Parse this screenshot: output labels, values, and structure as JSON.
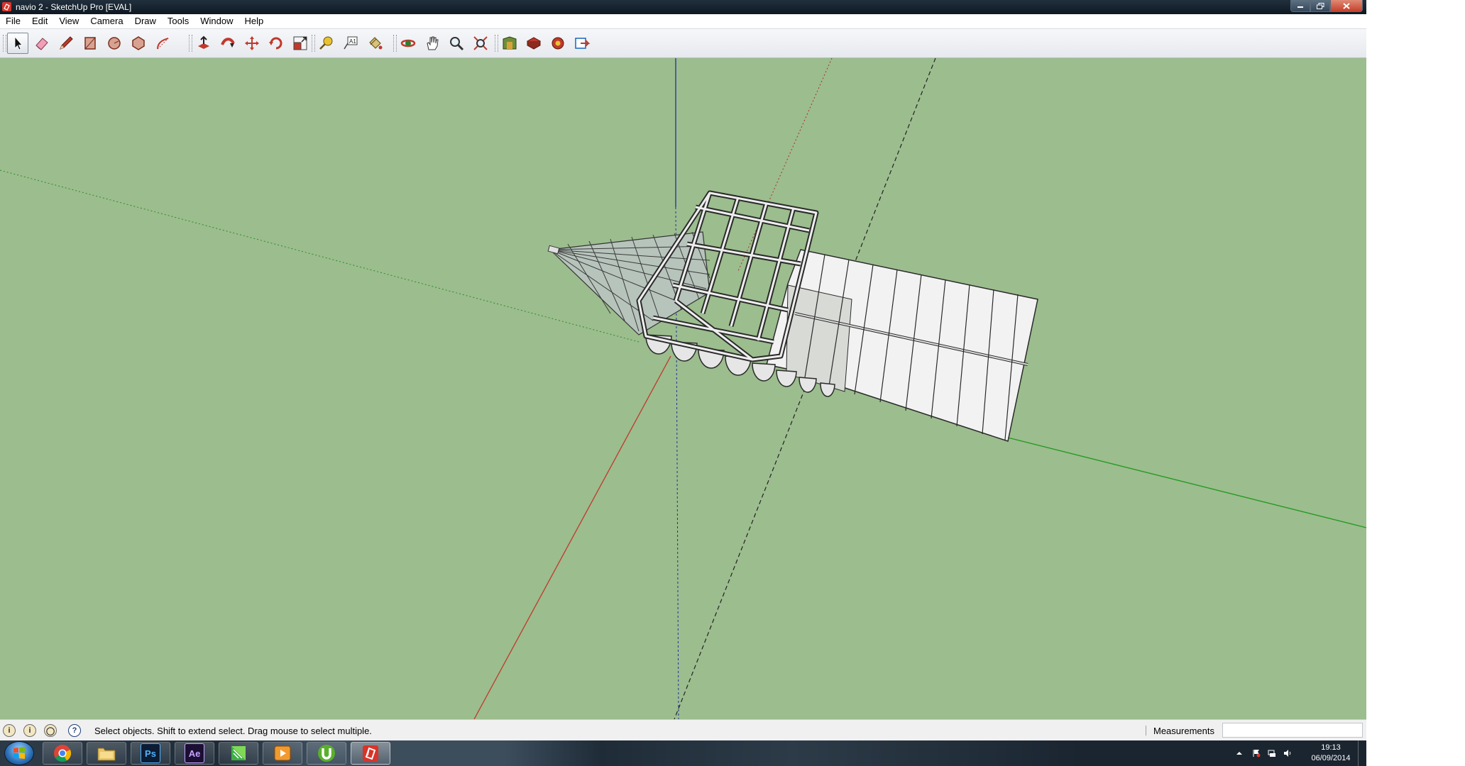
{
  "window": {
    "title": "navio 2 - SketchUp Pro [EVAL]",
    "controls": [
      "minimize-icon",
      "maximize-icon",
      "close-icon"
    ]
  },
  "menu": [
    "File",
    "Edit",
    "View",
    "Camera",
    "Draw",
    "Tools",
    "Window",
    "Help"
  ],
  "toolbar": {
    "tools": [
      {
        "name": "select-icon",
        "active": true
      },
      {
        "name": "eraser-icon"
      },
      {
        "name": "pencil-icon"
      },
      {
        "name": "rectangle-icon"
      },
      {
        "name": "circle-icon"
      },
      {
        "name": "polygon-icon"
      },
      {
        "name": "arc-icon"
      },
      {
        "name": "push-pull-icon"
      },
      {
        "name": "follow-me-icon"
      },
      {
        "name": "move-icon"
      },
      {
        "name": "rotate-icon"
      },
      {
        "name": "scale-icon"
      },
      {
        "name": "tape-measure-icon"
      },
      {
        "name": "text-icon"
      },
      {
        "name": "paint-bucket-icon"
      },
      {
        "name": "orbit-icon"
      },
      {
        "name": "pan-icon"
      },
      {
        "name": "zoom-icon"
      },
      {
        "name": "zoom-extents-icon"
      },
      {
        "name": "warehouse-icon"
      },
      {
        "name": "share-model-icon"
      },
      {
        "name": "extension-warehouse-icon"
      },
      {
        "name": "layout-icon"
      }
    ],
    "colors": {
      "viewport_bg": "#9cbd8e",
      "red_axis": "#c0392b",
      "green_axis": "#1f9a1f",
      "blue_axis": "#2030a0"
    }
  },
  "status": {
    "icons": [
      "geo-location-icon",
      "credits-icon",
      "sign-in-icon",
      "help-icon"
    ],
    "help_glyph": "?",
    "text": "Select objects. Shift to extend select. Drag mouse to select multiple.",
    "measurements_label": "Measurements",
    "measurements_value": ""
  },
  "taskbar": {
    "apps": [
      {
        "name": "chrome-icon",
        "label": ""
      },
      {
        "name": "file-explorer-icon",
        "label": ""
      },
      {
        "name": "photoshop-icon",
        "label": "Ps"
      },
      {
        "name": "after-effects-icon",
        "label": "Ae"
      },
      {
        "name": "green-app-icon",
        "label": ""
      },
      {
        "name": "media-player-icon",
        "label": ""
      },
      {
        "name": "utorrent-icon",
        "label": ""
      },
      {
        "name": "sketchup-icon",
        "label": "",
        "active": true
      }
    ],
    "clock_time": "19:13",
    "clock_date": "06/09/2014"
  }
}
